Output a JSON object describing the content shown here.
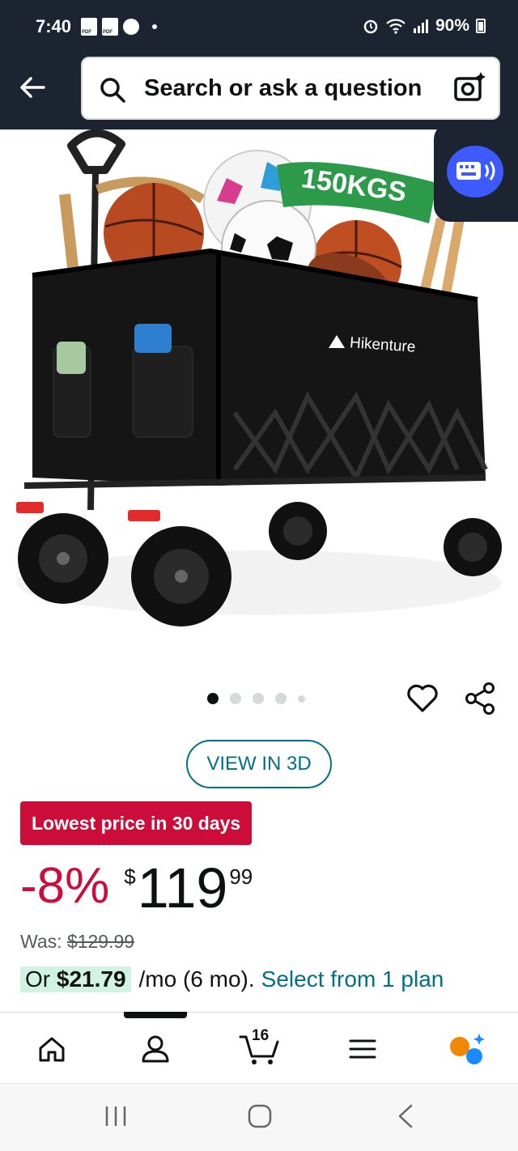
{
  "status_bar": {
    "time": "7:40",
    "battery": "90%"
  },
  "search": {
    "placeholder": "Search or ask a question"
  },
  "product_image": {
    "brand_text": "Hikenture",
    "capacity_text": "150KGS",
    "carousel_total": 5,
    "carousel_active": 1
  },
  "actions": {
    "view_3d": "VIEW IN 3D"
  },
  "pricing": {
    "deal_badge": "Lowest price in 30 days",
    "discount": "-8%",
    "currency": "$",
    "price_whole": "119",
    "price_fraction": "99",
    "was_label": "Was:",
    "was_price": "$129.99",
    "monthly_prefix": "Or",
    "monthly_amount": "$21.79",
    "monthly_term": "/mo (6 mo).",
    "monthly_link": "Select from 1 plan"
  },
  "bottom_nav": {
    "cart_count": "16",
    "active_tab": "account"
  },
  "colors": {
    "header_bg": "#1b2430",
    "deal_red": "#cc0c39",
    "link_teal": "#007185",
    "installment_green": "#d1f3e6",
    "assistant_orange": "#f08804",
    "assistant_blue": "#1a8cff"
  }
}
